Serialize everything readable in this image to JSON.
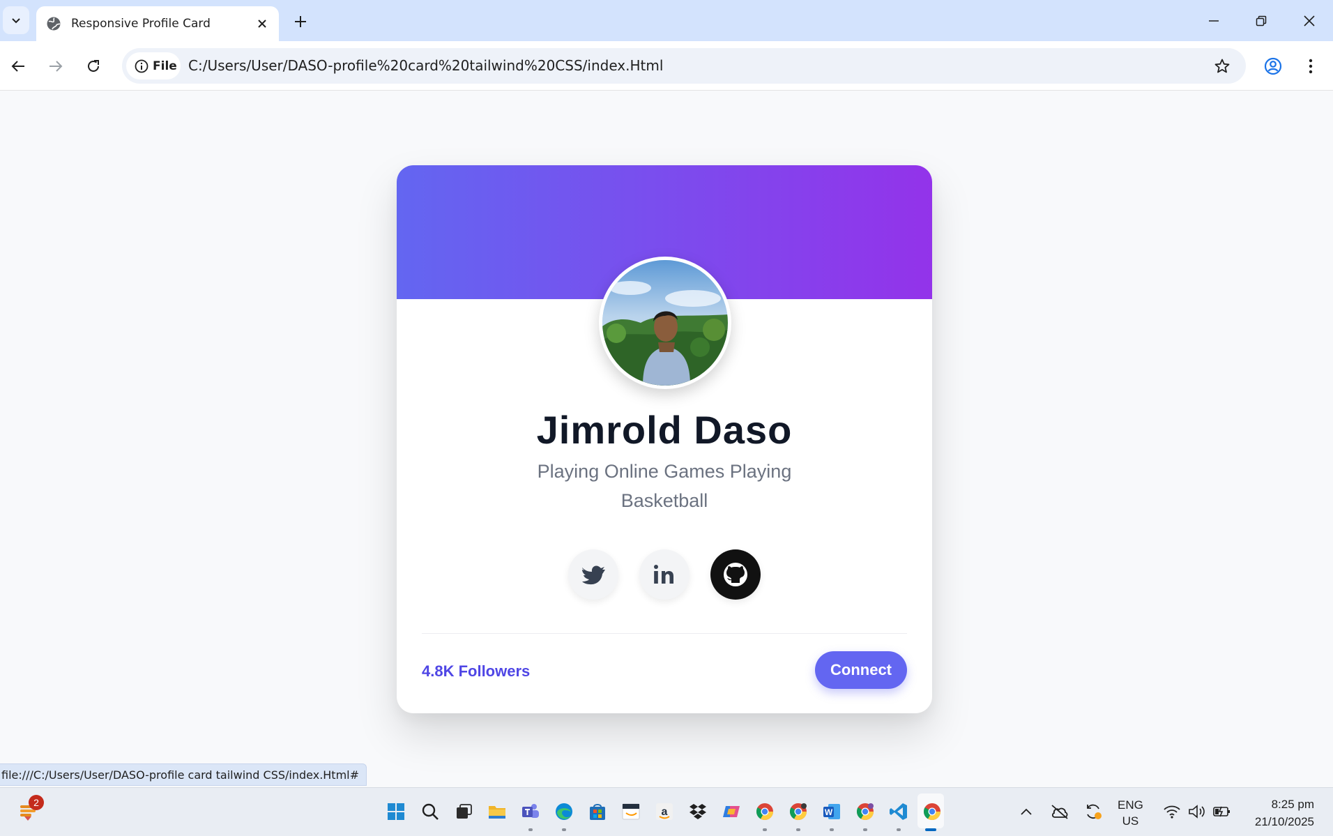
{
  "browser": {
    "tab_title": "Responsive Profile Card",
    "site_chip": "File",
    "url": "C:/Users/User/DASO-profile%20card%20tailwind%20CSS/index.Html",
    "status_url": "file:///C:/Users/User/DASO-profile card tailwind CSS/index.Html#"
  },
  "profile": {
    "name": "Jimrold Daso",
    "bio": "Playing Online Games Playing Basketball",
    "followers": "4.8K Followers",
    "connect_label": "Connect",
    "socials": [
      "twitter-icon",
      "linkedin-icon",
      "github-icon"
    ]
  },
  "colors": {
    "banner_start": "#6366f1",
    "banner_end": "#9333ea",
    "accent": "#4f46e5",
    "button": "#6366f1"
  },
  "taskbar": {
    "notification_badge": "2",
    "language": "ENG",
    "region": "US",
    "time": "8:25 pm",
    "date": "21/10/2025"
  }
}
